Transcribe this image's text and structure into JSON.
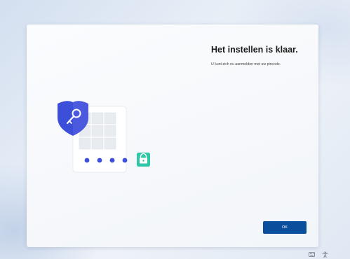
{
  "setup": {
    "title": "Het instellen is klaar.",
    "subtitle": "U kunt zich nu aanmelden met uw pincode.",
    "ok_label": "OK"
  },
  "illustration": {
    "pin_dots_count": 4,
    "shield_color": "#3b4fd8",
    "dot_color": "#3c4fe0",
    "lock_color": "#2fc7a6"
  },
  "tray": {
    "icons": [
      "keyboard-icon",
      "accessibility-icon"
    ]
  }
}
